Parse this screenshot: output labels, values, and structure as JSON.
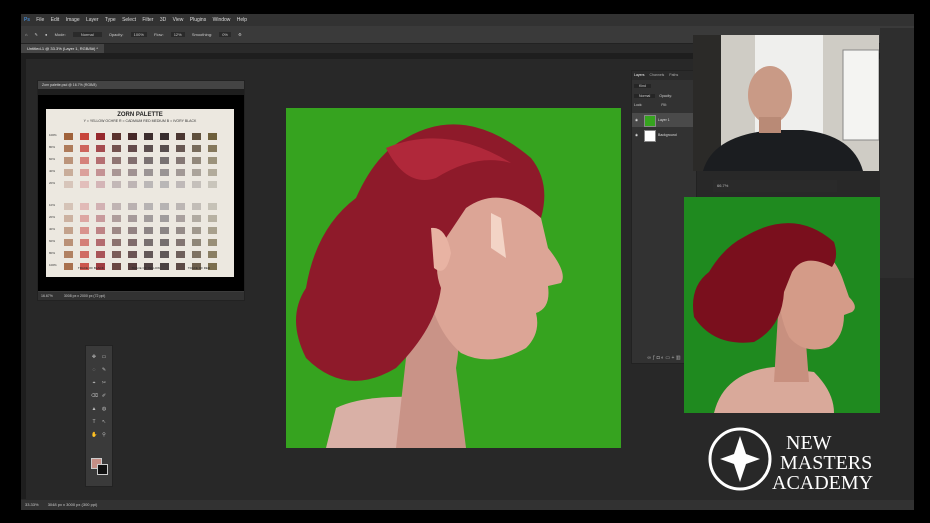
{
  "menu": [
    "File",
    "Edit",
    "Image",
    "Layer",
    "Type",
    "Select",
    "Filter",
    "3D",
    "View",
    "Plugins",
    "Window",
    "Help"
  ],
  "options": {
    "mode_label": "Mode:",
    "mode_value": "Normal",
    "opacity_label": "Opacity:",
    "opacity_value": "100%",
    "flow_label": "Flow:",
    "flow_value": "12%",
    "smoothing_label": "Smoothing:",
    "smoothing_value": "0%"
  },
  "doc_tab": "Untitled-1 @ 33.3% (Layer 1, RGB/8#) *",
  "ref_window": {
    "title": "Zorn palette.psd @ 16.7% (RGB/8)",
    "zoom": "16.67%",
    "size": "3008 px x 2000 px (72 ppi)",
    "palette_title": "ZORN PALETTE",
    "legend": "Y = YELLOW OCHRE    R = CADMIUM RED MEDIUM    B = IVORY BLACK",
    "column_labels": [
      "Y",
      "R",
      "B",
      "P"
    ],
    "row_labels": [
      "100%",
      "80%",
      "60%",
      "40%",
      "20%",
      "10%",
      "20%",
      "40%",
      "60%",
      "80%",
      "100%"
    ],
    "footer": [
      "TRACE OF BLACK",
      "TRACE OF YELLOW",
      "TRACE OF RED"
    ]
  },
  "layers_panel": {
    "tabs": [
      "Layers",
      "Channels",
      "Paths"
    ],
    "kind": "Kind",
    "blend": "Normal",
    "opacity": "Opacity:",
    "lock": "Lock:",
    "fill": "Fill:",
    "layers": [
      "Layer 1",
      "Background"
    ]
  },
  "ref_photo_bar": "66.7%",
  "status": {
    "zoom": "33.33%",
    "doc": "3048 px x 3000 px (300 ppi)"
  },
  "logo": {
    "line1": "NEW",
    "line2": "MASTERS",
    "line3": "ACADEMY"
  },
  "colors": {
    "canvas_green": "#36a31f",
    "hair_red": "#8e1a2a",
    "skin": "#d8a597",
    "ui_dark": "#282828"
  }
}
